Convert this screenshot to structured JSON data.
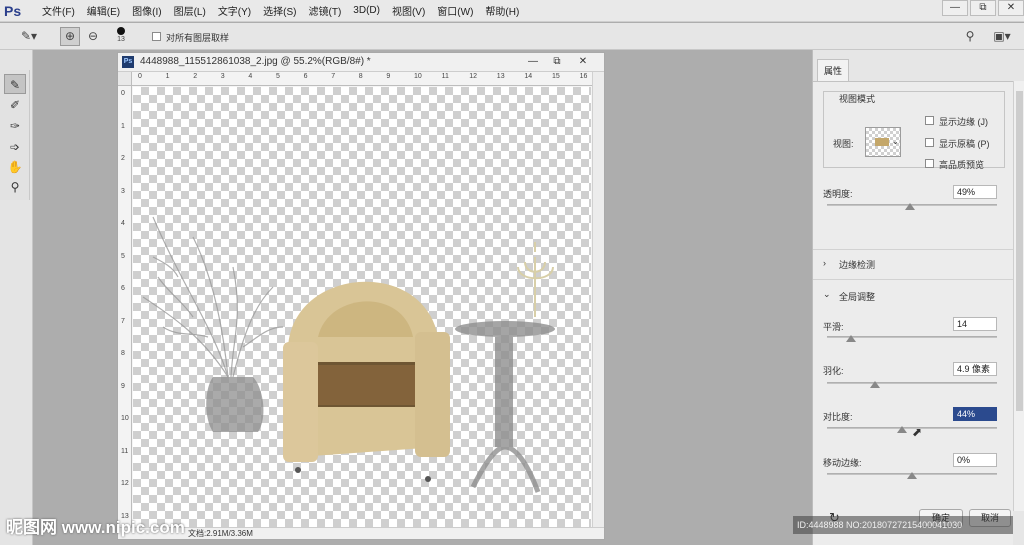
{
  "app": {
    "logo": "Ps"
  },
  "menu": [
    "文件(F)",
    "编辑(E)",
    "图像(I)",
    "图层(L)",
    "文字(Y)",
    "选择(S)",
    "滤镜(T)",
    "3D(D)",
    "视图(V)",
    "窗口(W)",
    "帮助(H)"
  ],
  "window_controls": {
    "minimize": "—",
    "restore": "⧉",
    "close": "✕"
  },
  "options_bar": {
    "brush_size": "13",
    "sample_all_layers_label": "对所有图层取样"
  },
  "document": {
    "title": "4448988_115512861038_2.jpg @ 55.2%(RGB/8#) *",
    "ruler_h": [
      "0",
      "1",
      "2",
      "3",
      "4",
      "5",
      "6",
      "7",
      "8",
      "9",
      "10",
      "11",
      "12",
      "13",
      "14",
      "15",
      "16"
    ],
    "ruler_v": [
      "0",
      "1",
      "2",
      "3",
      "4",
      "5",
      "6",
      "7",
      "8",
      "9",
      "10",
      "11",
      "12",
      "13"
    ],
    "status": "文档:2.91M/3.36M"
  },
  "properties": {
    "tab": "属性",
    "view_mode_title": "视图模式",
    "view_label": "视图:",
    "show_edge": "显示边缘 (J)",
    "show_original": "显示原稿 (P)",
    "hq_preview": "高品质预览",
    "opacity_label": "透明度:",
    "opacity_value": "49%",
    "opacity_level": 0.49,
    "edge_detection": "边缘检测",
    "global_adjust": "全局调整",
    "smooth_label": "平滑:",
    "smooth_value": "14",
    "smooth_level": 0.14,
    "feather_label": "羽化:",
    "feather_value": "4.9 像素",
    "feather_level": 0.28,
    "contrast_label": "对比度:",
    "contrast_value": "44%",
    "contrast_level": 0.44,
    "shift_edge_label": "移动边缘:",
    "shift_edge_value": "0%",
    "shift_edge_level": 0.5,
    "ok": "确定",
    "cancel": "取消"
  },
  "watermark": {
    "left": "昵图网 www.nipic.com",
    "right": "ID:4448988 NO:20180727215400041030"
  }
}
